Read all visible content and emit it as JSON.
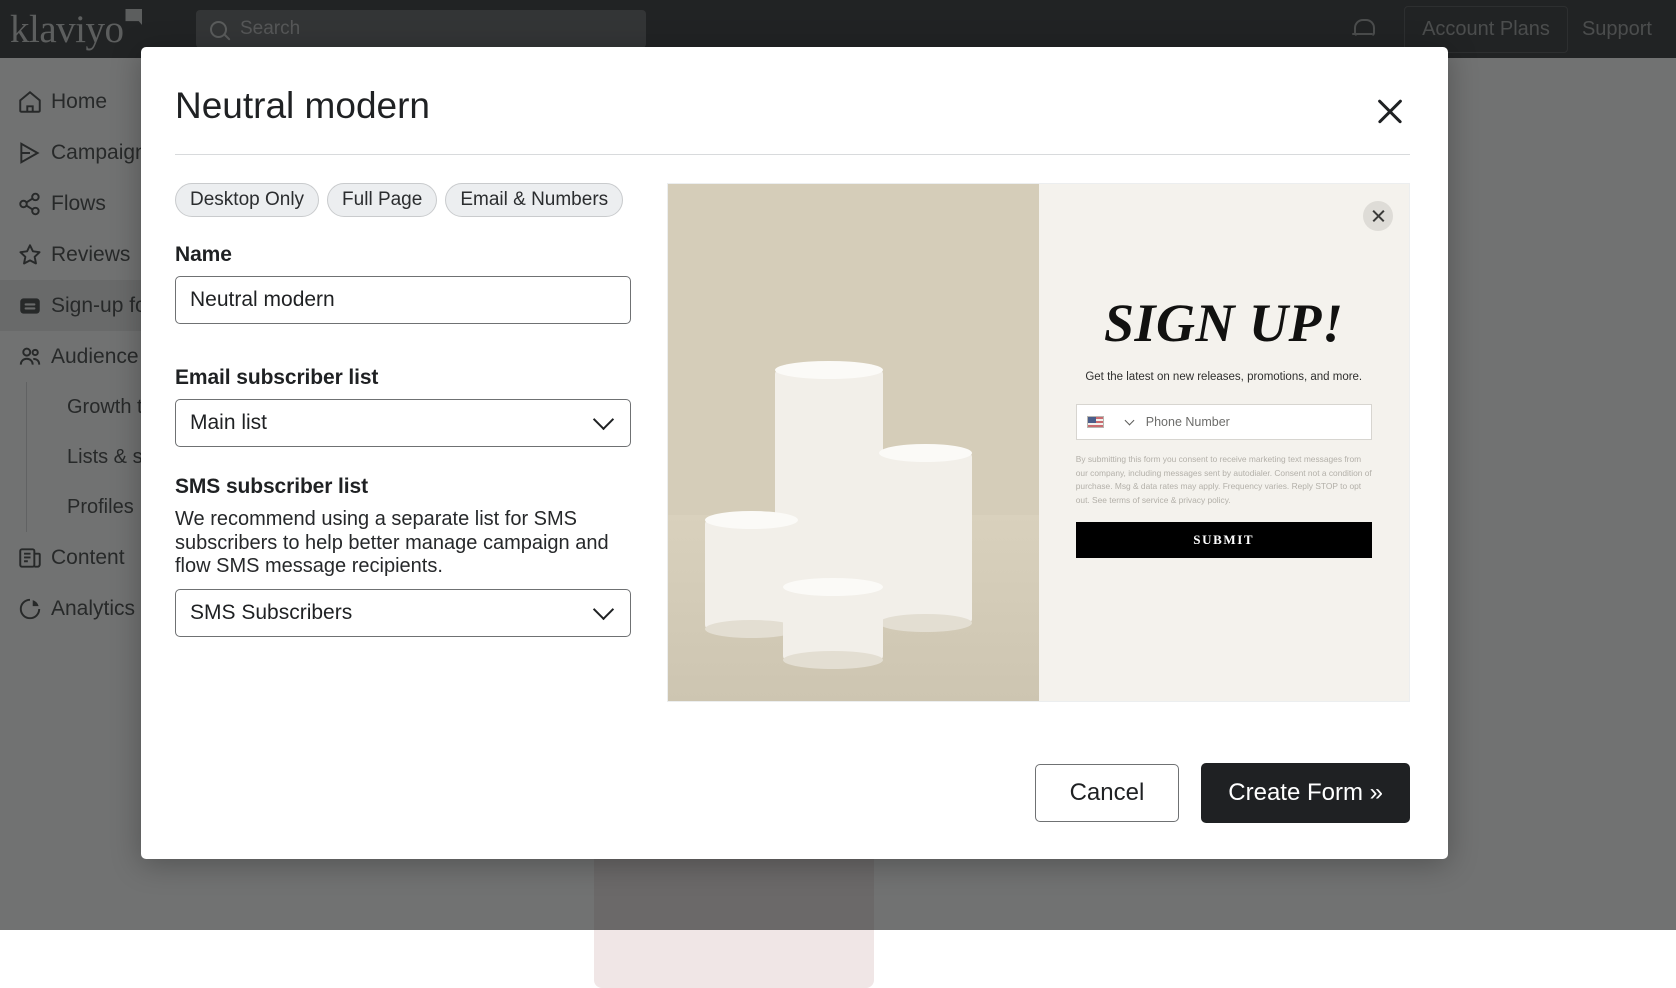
{
  "topbar": {
    "brand": "klaviyo",
    "search_placeholder": "Search",
    "account_plans": "Account Plans",
    "support": "Support"
  },
  "sidebar": {
    "items": [
      {
        "label": "Home",
        "icon": "home-icon"
      },
      {
        "label": "Campaigns",
        "icon": "campaigns-icon"
      },
      {
        "label": "Flows",
        "icon": "flows-icon"
      },
      {
        "label": "Reviews",
        "icon": "star-icon"
      },
      {
        "label": "Sign-up forms",
        "icon": "signup-forms-icon",
        "active": true
      },
      {
        "label": "Audience",
        "icon": "audience-icon"
      }
    ],
    "sub_items": [
      {
        "label": "Growth tools"
      },
      {
        "label": "Lists & segments"
      },
      {
        "label": "Profiles"
      }
    ],
    "items_bottom": [
      {
        "label": "Content",
        "icon": "content-icon"
      },
      {
        "label": "Analytics",
        "icon": "analytics-icon"
      }
    ]
  },
  "modal": {
    "title": "Neutral modern",
    "close_label": "close-icon",
    "chips": [
      "Desktop Only",
      "Full Page",
      "Email & Numbers"
    ],
    "name": {
      "label": "Name",
      "value": "Neutral modern"
    },
    "email_list": {
      "label": "Email subscriber list",
      "value": "Main list"
    },
    "sms_list": {
      "label": "SMS subscriber list",
      "help": "We recommend using a separate list for SMS subscribers to help better manage campaign and flow SMS message recipients.",
      "value": "SMS Subscribers"
    },
    "footer": {
      "cancel": "Cancel",
      "create": "Create Form »"
    }
  },
  "preview": {
    "title": "SIGN UP!",
    "subtitle": "Get the latest on new releases, promotions, and more.",
    "phone_placeholder": "Phone Number",
    "country_flag": "us-flag-icon",
    "consent": "By submitting this form you consent to receive marketing text messages from our company, including messages sent by autodialer. Consent not a condition of purchase. Msg & data rates may apply. Frequency varies. Reply STOP to opt out. See terms of service & privacy policy.",
    "submit": "SUBMIT",
    "close_label": "preview-close-icon"
  },
  "colors": {
    "topbar_bg": "#2f3032",
    "modal_bg": "#ffffff",
    "primary_button": "#1f2123",
    "preview_photo_bg": "#d5cdb9",
    "preview_form_bg": "#f4f2ed"
  }
}
